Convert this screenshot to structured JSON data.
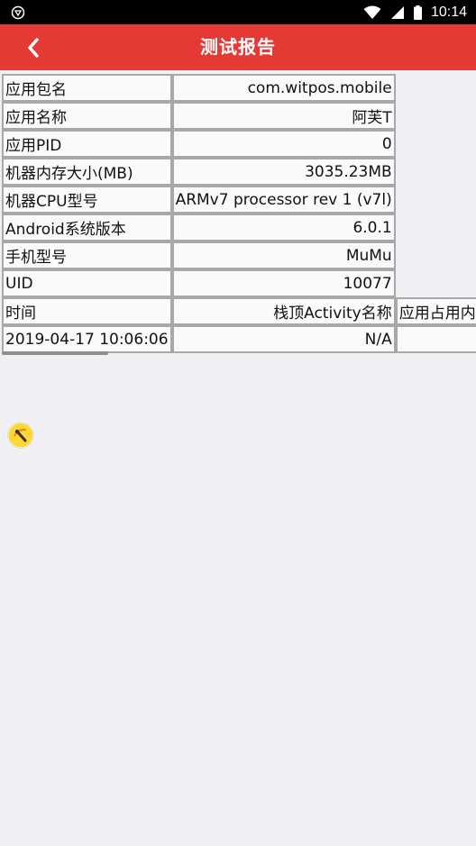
{
  "status_bar": {
    "time": "10:14",
    "icons": [
      "app-notification-icon",
      "wifi-icon",
      "signal-icon",
      "battery-icon"
    ]
  },
  "app_bar": {
    "title": "测试报告",
    "back_icon": "chevron-left-icon"
  },
  "report": {
    "rows": [
      {
        "key": "应用包名",
        "value": "com.witpos.mobile"
      },
      {
        "key": "应用名称",
        "value": "阿芙T"
      },
      {
        "key": "应用PID",
        "value": "0"
      },
      {
        "key": "机器内存大小(MB)",
        "value": "3035.23MB"
      },
      {
        "key": "机器CPU型号",
        "value": "ARMv7 processor rev 1 (v7l)"
      },
      {
        "key": "Android系统版本",
        "value": "6.0.1"
      },
      {
        "key": "手机型号",
        "value": "MuMu"
      },
      {
        "key": "UID",
        "value": "10077"
      }
    ],
    "header_row": {
      "col1": "时间",
      "col2": "栈顶Activity名称",
      "col3": "应用占用内"
    },
    "data_row": {
      "col1": "2019-04-17 10:06:06",
      "col2": "N/A",
      "col3": ""
    }
  },
  "floating_button": {
    "icon": "floating-tool-icon"
  },
  "colors": {
    "app_bar": "#e53935",
    "background": "#efeff4",
    "cell_border": "#a8a8a8"
  }
}
